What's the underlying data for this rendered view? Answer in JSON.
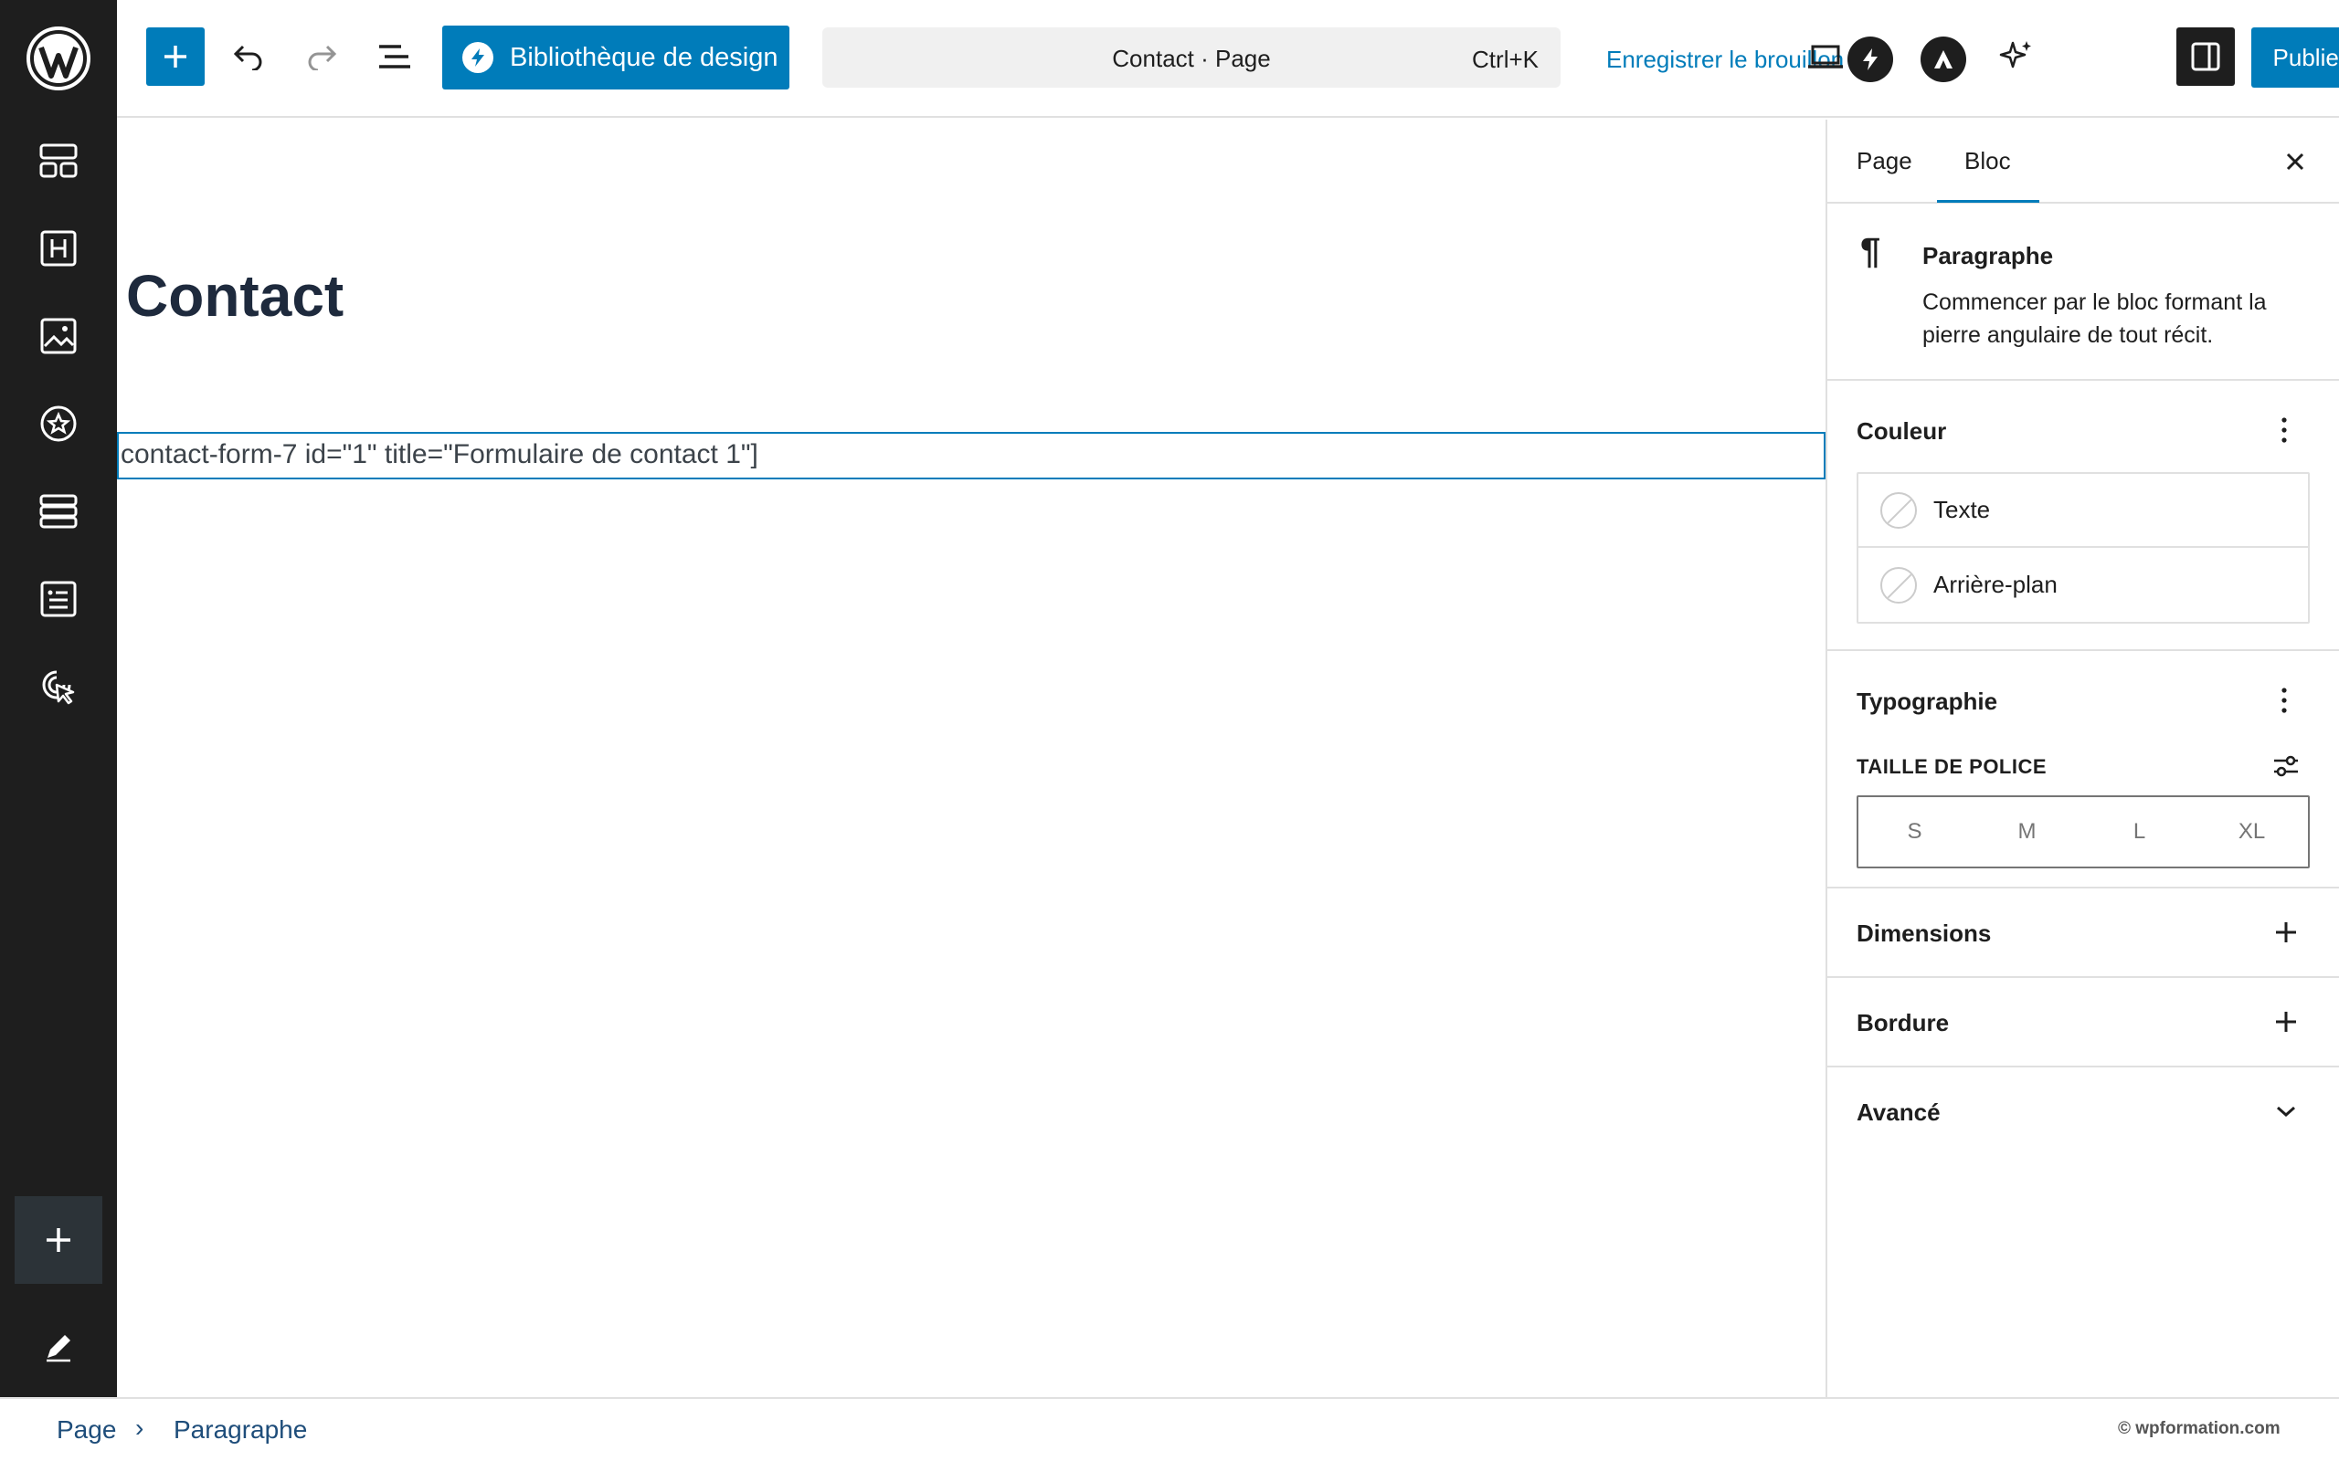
{
  "topbar": {
    "design_library_label": "Bibliothèque de design",
    "command_title": "Contact · Page",
    "command_shortcut": "Ctrl+K",
    "save_draft_label": "Enregistrer le brouillon",
    "publish_label": "Publier"
  },
  "canvas": {
    "page_title": "Contact",
    "shortcode_text": "contact-form-7 id=\"1\" title=\"Formulaire de contact 1\"]"
  },
  "sidebar": {
    "tabs": [
      {
        "label": "Page"
      },
      {
        "label": "Bloc"
      }
    ],
    "active_tab": "Bloc",
    "block": {
      "title": "Paragraphe",
      "description": "Commencer par le bloc formant la pierre angulaire de tout récit."
    },
    "color_panel": {
      "title": "Couleur",
      "items": [
        {
          "label": "Texte"
        },
        {
          "label": "Arrière-plan"
        }
      ]
    },
    "typography_panel": {
      "title": "Typographie",
      "font_size_label": "TAILLE DE POLICE",
      "sizes": [
        "S",
        "M",
        "L",
        "XL"
      ]
    },
    "dimensions_title": "Dimensions",
    "border_title": "Bordure",
    "advanced_title": "Avancé"
  },
  "statusbar": {
    "breadcrumb": [
      "Page",
      "Paragraphe"
    ],
    "watermark": "© wpformation.com"
  },
  "colors": {
    "accent": "#007cba",
    "rail": "#1e1e1e"
  }
}
